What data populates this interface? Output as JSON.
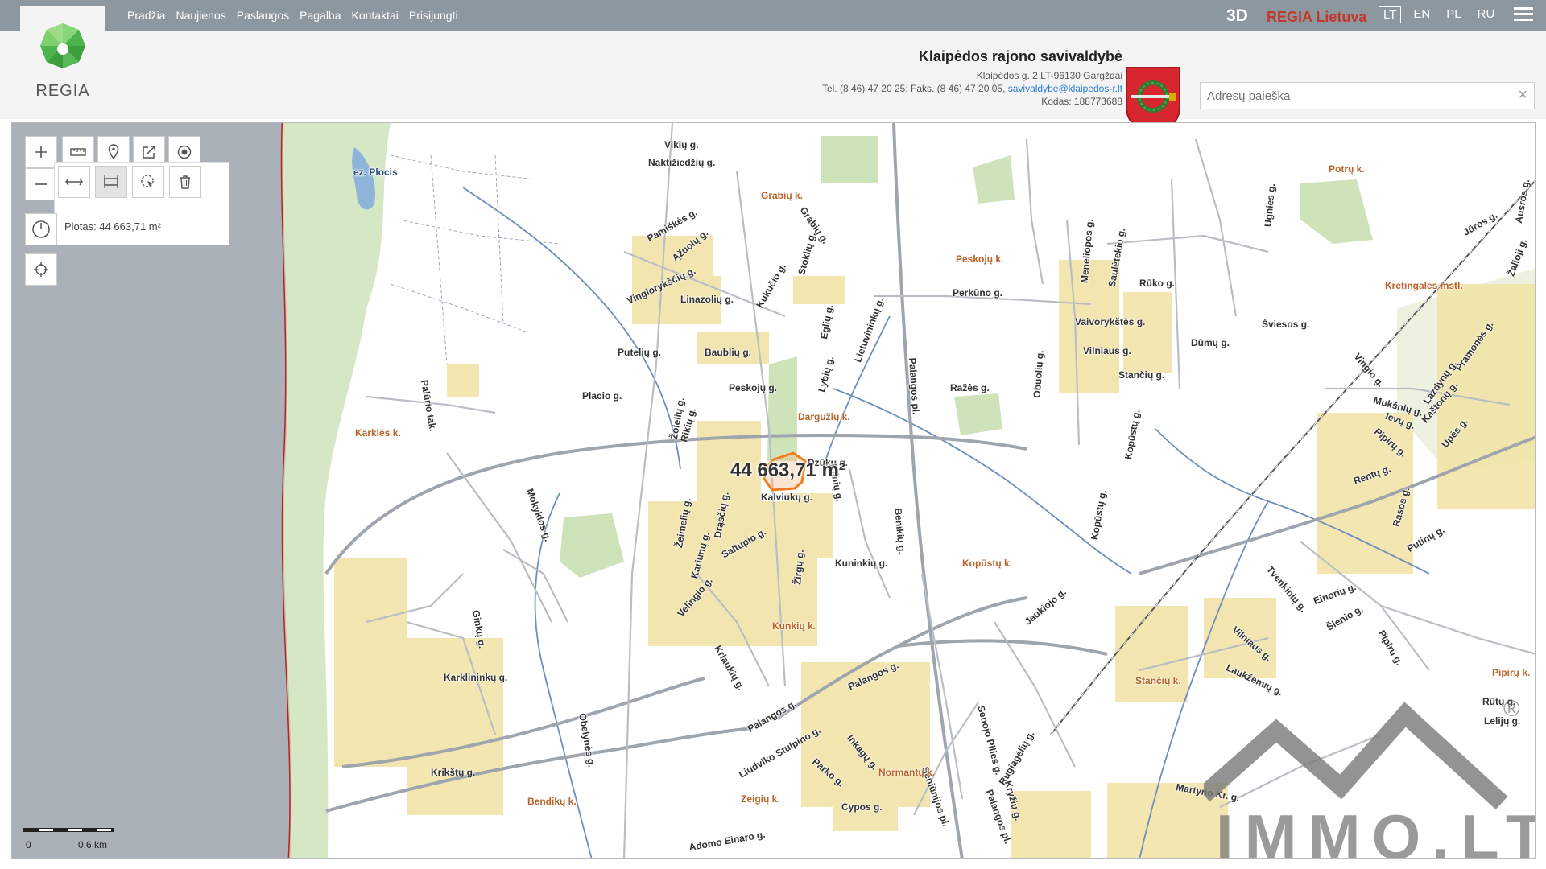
{
  "nav": {
    "items": [
      "Pradžia",
      "Naujienos",
      "Paslaugos",
      "Pagalba",
      "Kontaktai",
      "Prisijungti"
    ],
    "btn_3d": "3D",
    "regia_lietuva": "REGIA Lietuva",
    "languages": [
      "LT",
      "EN",
      "PL",
      "RU"
    ],
    "active_language": "LT"
  },
  "logo": {
    "text": "REGIA"
  },
  "municipality": {
    "name": "Klaipėdos rajono savivaldybė",
    "address": "Klaipėdos g. 2 LT-96130 Gargždai",
    "phone_fax": "Tel. (8 46) 47 20 25; Faks. (8 46) 47 20 05,",
    "email": "savivaldybe@klaipedos-r.lt",
    "code": "Kodas: 188773688"
  },
  "search": {
    "placeholder": "Adresų paieška",
    "clear": "×"
  },
  "measure": {
    "area_label": "Plotas: 44 663,71 m²",
    "overlay": "44 663,71 m²"
  },
  "scale": {
    "zero": "0",
    "value": "0.6 km"
  },
  "watermark": {
    "text": "IMMO.LT",
    "registered": "®"
  },
  "map_labels": {
    "lake": "ez. Plocis",
    "streets": [
      "Vikių g.",
      "Naktižiedžių g.",
      "Pamiškės g.",
      "Ąžuolų g.",
      "Grabių g.",
      "Vingiorykščių g.",
      "Linazolių g.",
      "Kukučio g.",
      "Stoklių g.",
      "Eglių g.",
      "Lietuvininkų g.",
      "Baublių g.",
      "Putelių g.",
      "Peskojų g.",
      "Placio g.",
      "Lybių g.",
      "Perkūno g.",
      "Palangos pl.",
      "Rūko g.",
      "Vaivorykštės g.",
      "Vilniaus g.",
      "Dūmų g.",
      "Šviesos g.",
      "Stančių g.",
      "Obuolių g.",
      "Kopūstų g.",
      "Ražės g.",
      "Palūrio tak.",
      "Žolelių g.",
      "Rikių g.",
      "Kalviukų g.",
      "Dzūkų g.",
      "Kilnių g.",
      "Mokyklos g.",
      "Žeimelių g.",
      "Drąsčių g.",
      "Saltupio g.",
      "Kuninkių g.",
      "Benikių g.",
      "Kopūstų g.",
      "Jaukiojo g.",
      "Velingio g.",
      "Kariūnų g.",
      "Žirgų g.",
      "Ginkų g.",
      "Karklininkų g.",
      "Kriaukių g.",
      "Palangos g.",
      "Obelynės g.",
      "Krikštų g.",
      "Palangos g.",
      "Liudviko Stulpino g.",
      "Inkagų g.",
      "Parko g.",
      "Cypos g.",
      "Seniūnijos pl.",
      "Senojo Pilies g.",
      "Rugiagėlių g.",
      "Kryžių g.",
      "Palangos pl.",
      "Adomo Einaro g.",
      "Martyno Kr. g.",
      "Ugnies g.",
      "Meneliopos g.",
      "Saulėtekio g.",
      "Kretingalės mstl.",
      "Jūros g.",
      "Ausros g.",
      "Žalioji g.",
      "Vingio g.",
      "Pramonės g.",
      "Lazdynų g.",
      "Kaštonų g.",
      "Ievų g.",
      "Upės g.",
      "Pipirų g.",
      "Rentų g.",
      "Mukšnių g.",
      "Rasos g.",
      "Putinų g.",
      "Tvenkinių g.",
      "Einorių g.",
      "Šlenio g.",
      "Vilniaus g.",
      "Laukžemių g.",
      "Pipiru g.",
      "Rūtų g.",
      "Lelijų g."
    ],
    "villages": [
      "Grabių k.",
      "Potrų k.",
      "Peskojų k.",
      "Dargužių k.",
      "Karklės k.",
      "Kopūstų k.",
      "Kunkių k.",
      "Stančių k.",
      "Pipirų k.",
      "Normantų k.",
      "Bendikų k.",
      "Zeigių k."
    ]
  }
}
